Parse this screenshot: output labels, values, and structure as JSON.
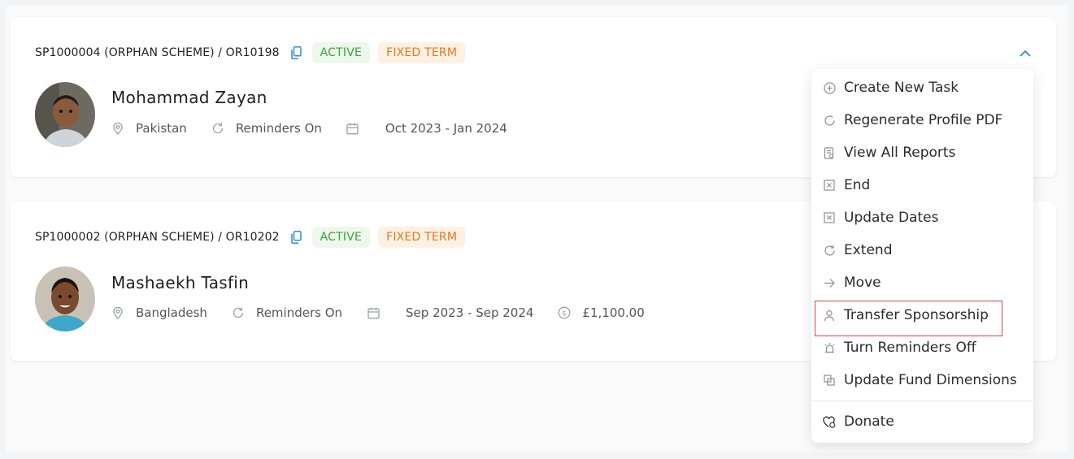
{
  "sponsorships": [
    {
      "reference": "SP1000004 (ORPHAN SCHEME) / OR10198",
      "status": "ACTIVE",
      "term": "FIXED TERM",
      "name": "Mohammad Zayan",
      "country": "Pakistan",
      "reminders": "Reminders On",
      "period": "Oct 2023 - Jan 2024"
    },
    {
      "reference": "SP1000002 (ORPHAN SCHEME) / OR10202",
      "status": "ACTIVE",
      "term": "FIXED TERM",
      "name": "Mashaekh Tasfin",
      "country": "Bangladesh",
      "reminders": "Reminders On",
      "period": "Sep 2023 - Sep 2024",
      "amount": "£1,100.00"
    }
  ],
  "menu": {
    "items": [
      {
        "label": "Create New Task",
        "icon": "plus-circle-icon"
      },
      {
        "label": "Regenerate Profile PDF",
        "icon": "refresh-icon"
      },
      {
        "label": "View All Reports",
        "icon": "report-icon"
      },
      {
        "label": "End",
        "icon": "x-square-icon"
      },
      {
        "label": "Update Dates",
        "icon": "x-square-icon"
      },
      {
        "label": "Extend",
        "icon": "refresh-icon"
      },
      {
        "label": "Move",
        "icon": "arrow-right-icon"
      },
      {
        "label": "Transfer Sponsorship",
        "icon": "user-icon"
      },
      {
        "label": "Turn Reminders Off",
        "icon": "alarm-icon"
      },
      {
        "label": "Update Fund Dimensions",
        "icon": "copy-icon"
      }
    ],
    "footer_item": {
      "label": "Donate",
      "icon": "heart-dollar-icon"
    }
  },
  "colors": {
    "accent": "#2e8bd8",
    "active_text": "#38a634",
    "active_bg": "#eef7ec",
    "fixed_text": "#e2781d",
    "fixed_bg": "#fdf1e3",
    "highlight_border": "#d6453d"
  }
}
